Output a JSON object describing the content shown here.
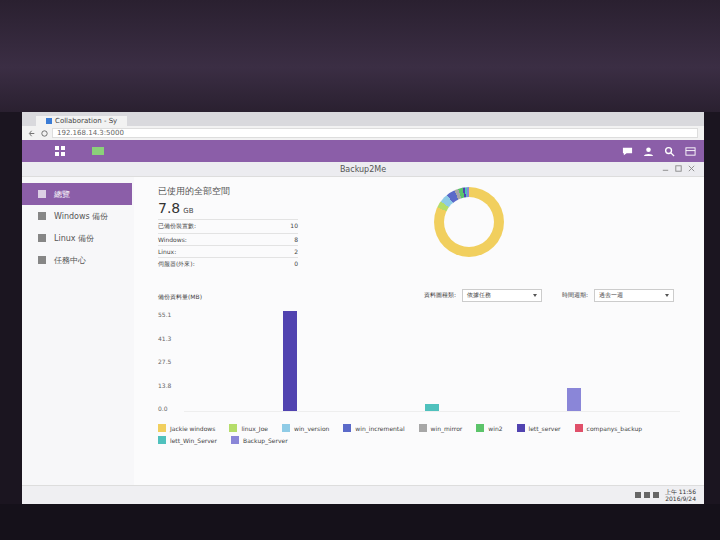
{
  "browser": {
    "tab": "Collaboration - Sy",
    "address": "192.168.14.3:5000"
  },
  "window": {
    "title": "Backup2Me"
  },
  "sidebar": {
    "items": [
      {
        "label": "總覽",
        "selected": true
      },
      {
        "label": "Windows 備份",
        "selected": false
      },
      {
        "label": "Linux 備份",
        "selected": false
      },
      {
        "label": "任務中心",
        "selected": false
      }
    ]
  },
  "summary": {
    "title": "已使用的全部空間",
    "value": "7.8",
    "unit": "GB",
    "rows": [
      {
        "label": "已備份裝置數:",
        "value": "10"
      },
      {
        "label": "Windows:",
        "value": "8"
      },
      {
        "label": "Linux:",
        "value": "2"
      },
      {
        "label": "伺服器(外來):",
        "value": "0"
      }
    ]
  },
  "chart": {
    "title": "備份資料量(MB)",
    "filters": [
      {
        "label": "資料圖種類:",
        "value": "依據任務"
      },
      {
        "label": "時間週期:",
        "value": "過去一週"
      }
    ],
    "ticks": [
      "55.1",
      "41.3",
      "27.5",
      "13.8",
      "0.0"
    ],
    "max": 55.1,
    "series": [
      {
        "name": "Jackie windows",
        "color": "#f1cf5e",
        "share": 0.82,
        "values": [
          0,
          0,
          0,
          0,
          0,
          0,
          0
        ]
      },
      {
        "name": "linux_Joe",
        "color": "#b5dd6a",
        "share": 0.03,
        "values": [
          0,
          0,
          0,
          0,
          0,
          0,
          0
        ]
      },
      {
        "name": "win_version",
        "color": "#8fcbe6",
        "share": 0.04,
        "values": [
          0,
          0,
          0,
          0,
          0,
          0,
          0
        ]
      },
      {
        "name": "win_incremental",
        "color": "#5b6ac9",
        "share": 0.04,
        "values": [
          0,
          0,
          0,
          0,
          0,
          0,
          0
        ]
      },
      {
        "name": "win_mirror",
        "color": "#a7a7a7",
        "share": 0.02,
        "values": [
          0,
          0,
          0,
          0,
          0,
          0,
          0
        ]
      },
      {
        "name": "win2",
        "color": "#5cc46a",
        "share": 0.02,
        "values": [
          0,
          0,
          0,
          0,
          0,
          0,
          0
        ]
      },
      {
        "name": "lett_server",
        "color": "#5143b0",
        "share": 0.01,
        "values": [
          0,
          55.1,
          0,
          0,
          0,
          0,
          0
        ]
      },
      {
        "name": "companys_backup",
        "color": "#e0506a",
        "share": 0,
        "values": [
          0,
          0,
          0,
          0,
          0,
          0,
          0
        ]
      },
      {
        "name": "lett_Win_Server",
        "color": "#4fc1bd",
        "share": 0.01,
        "values": [
          0,
          0,
          0,
          3.8,
          0,
          0,
          0
        ]
      },
      {
        "name": "Backup_Server",
        "color": "#8a86d8",
        "share": 0.01,
        "values": [
          0,
          0,
          0,
          0,
          0,
          12.5,
          0
        ]
      }
    ]
  },
  "taskbar": {
    "time": "上午 11:56",
    "date": "2016/9/24"
  }
}
